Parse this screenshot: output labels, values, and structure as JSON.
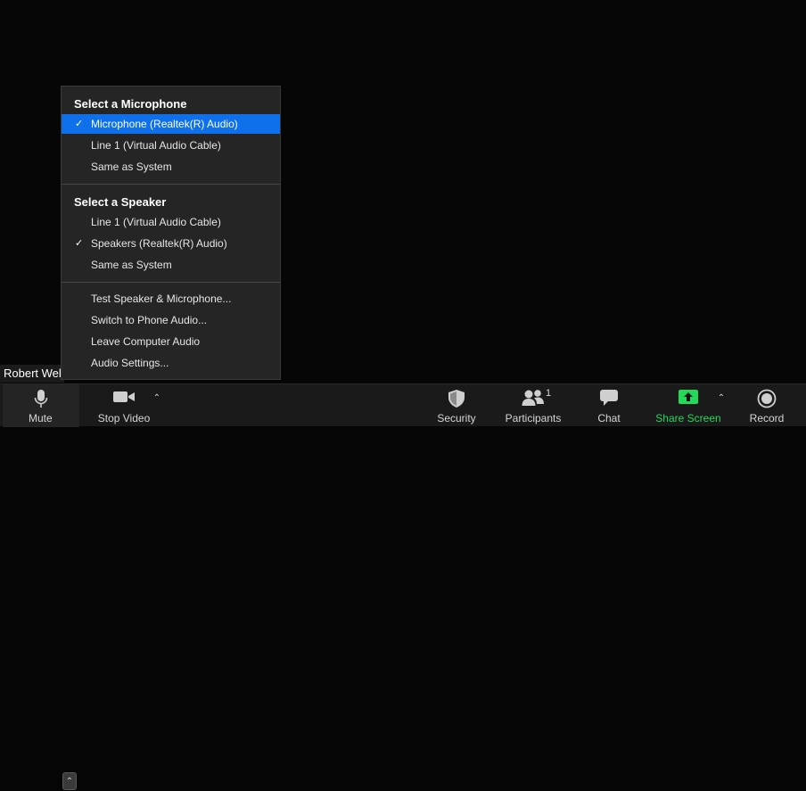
{
  "participant": {
    "name": "Robert Wel"
  },
  "audio_menu": {
    "microphone": {
      "title": "Select a Microphone",
      "items": [
        {
          "label": "Microphone (Realtek(R) Audio)",
          "checked": true
        },
        {
          "label": "Line 1 (Virtual Audio Cable)",
          "checked": false
        },
        {
          "label": "Same as System",
          "checked": false
        }
      ]
    },
    "speaker": {
      "title": "Select a Speaker",
      "items": [
        {
          "label": "Line 1 (Virtual Audio Cable)",
          "checked": false
        },
        {
          "label": "Speakers (Realtek(R) Audio)",
          "checked": true
        },
        {
          "label": "Same as System",
          "checked": false
        }
      ]
    },
    "actions": [
      {
        "label": "Test Speaker & Microphone..."
      },
      {
        "label": "Switch to Phone Audio..."
      },
      {
        "label": "Leave Computer Audio"
      },
      {
        "label": "Audio Settings..."
      }
    ],
    "check_glyph": "✓",
    "selected_color": "#0e71eb"
  },
  "toolbar": {
    "mute": {
      "label": "Mute",
      "icon": "microphone-icon"
    },
    "stop_video": {
      "label": "Stop Video",
      "icon": "video-camera-icon"
    },
    "security": {
      "label": "Security",
      "icon": "shield-icon"
    },
    "participants": {
      "label": "Participants",
      "count": "1",
      "icon": "participants-icon"
    },
    "chat": {
      "label": "Chat",
      "icon": "chat-bubble-icon"
    },
    "share_screen": {
      "label": "Share Screen",
      "icon": "share-screen-icon",
      "color": "#23d959"
    },
    "record": {
      "label": "Record",
      "icon": "record-icon"
    },
    "caret_glyph": "⌃"
  }
}
